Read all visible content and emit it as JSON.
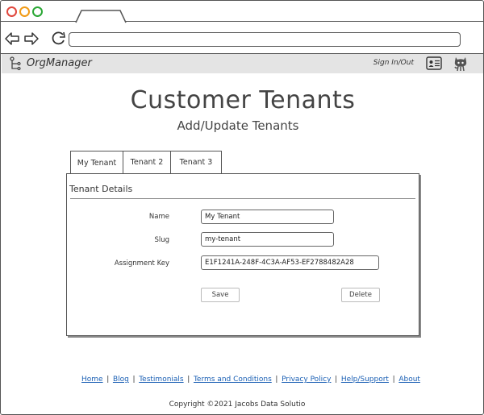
{
  "browser": {
    "address_value": ""
  },
  "appbar": {
    "brand": "OrgManager",
    "signin": "Sign In/Out"
  },
  "page": {
    "title": "Customer Tenants",
    "subtitle": "Add/Update Tenants"
  },
  "tabs": [
    {
      "label": "My Tenant",
      "active": true
    },
    {
      "label": "Tenant 2",
      "active": false
    },
    {
      "label": "Tenant 3",
      "active": false
    }
  ],
  "panel": {
    "title": "Tenant Details",
    "name_label": "Name",
    "name_value": "My Tenant",
    "slug_label": "Slug",
    "slug_value": "my-tenant",
    "key_label": "Assignment Key",
    "key_value": "E1F1241A-248F-4C3A-AF53-EF2788482A28",
    "save_label": "Save",
    "delete_label": "Delete"
  },
  "footer": {
    "links": [
      "Home",
      "Blog",
      "Testimonials",
      "Terms and Conditions",
      "Privacy Policy",
      "Help/Support",
      "About"
    ],
    "separator": "|",
    "copyright": "Copyright ©2021 Jacobs Data Solutio"
  },
  "colors": {
    "close": "#e0483e",
    "minimize": "#f19b16",
    "maximize": "#2aa735",
    "link": "#1a5fb4",
    "appbar_bg": "#e4e4e4"
  }
}
